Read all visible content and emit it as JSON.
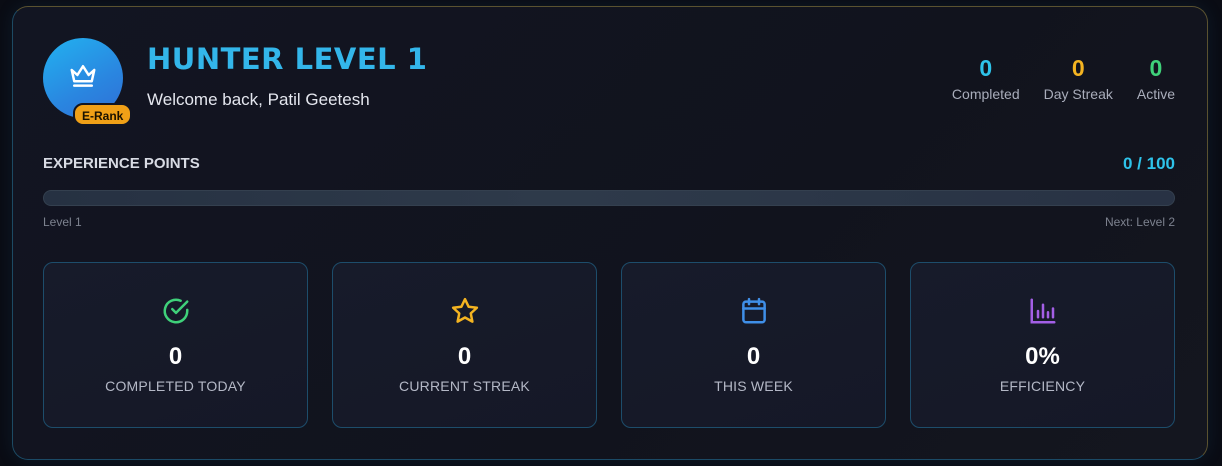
{
  "profile": {
    "title": "HUNTER LEVEL 1",
    "welcome": "Welcome back, Patil Geetesh",
    "rank_badge": "E-Rank"
  },
  "top_stats": [
    {
      "value": "0",
      "label": "Completed",
      "color": "#2ec3ea"
    },
    {
      "value": "0",
      "label": "Day Streak",
      "color": "#f4b421"
    },
    {
      "value": "0",
      "label": "Active",
      "color": "#3fd17a"
    }
  ],
  "experience": {
    "label": "EXPERIENCE POINTS",
    "value": "0 / 100",
    "progress": 0,
    "level_left": "Level 1",
    "level_right": "Next: Level 2"
  },
  "cards": [
    {
      "icon": "check-circle-icon",
      "value": "0",
      "label": "COMPLETED TODAY",
      "color": "#3fd17a"
    },
    {
      "icon": "star-icon",
      "value": "0",
      "label": "CURRENT STREAK",
      "color": "#f4b421"
    },
    {
      "icon": "calendar-icon",
      "value": "0",
      "label": "THIS WEEK",
      "color": "#3f8fe8"
    },
    {
      "icon": "bar-chart-icon",
      "value": "0%",
      "label": "EFFICIENCY",
      "color": "#a35fe6"
    }
  ]
}
